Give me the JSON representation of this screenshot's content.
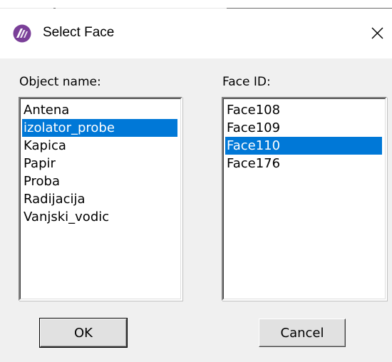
{
  "window": {
    "title": "Select Face"
  },
  "icons": {
    "app": "app-logo-icon",
    "close": "close-icon"
  },
  "object_list": {
    "label": "Object name:",
    "items": [
      "Antena",
      "izolator_probe",
      "Kapica",
      "Papir",
      "Proba",
      "Radijacija",
      "Vanjski_vodic"
    ],
    "selected": "izolator_probe"
  },
  "face_list": {
    "label": "Face ID:",
    "items": [
      "Face108",
      "Face109",
      "Face110",
      "Face176"
    ],
    "selected": "Face110"
  },
  "buttons": {
    "ok": "OK",
    "cancel": "Cancel"
  },
  "colors": {
    "selection": "#0078d7",
    "background": "#f0f0f0"
  }
}
